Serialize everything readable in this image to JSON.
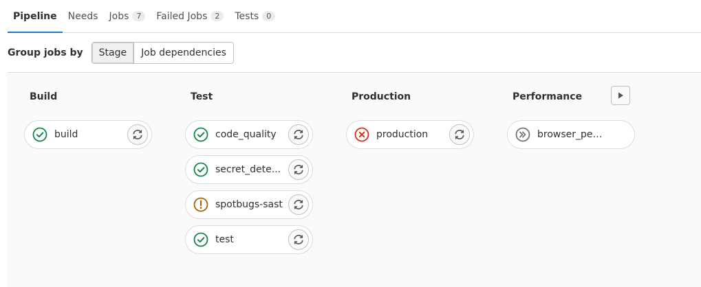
{
  "tabs": [
    {
      "label": "Pipeline",
      "active": true
    },
    {
      "label": "Needs"
    },
    {
      "label": "Jobs",
      "count": "7"
    },
    {
      "label": "Failed Jobs",
      "count": "2"
    },
    {
      "label": "Tests",
      "count": "0"
    }
  ],
  "group_by": {
    "label": "Group jobs by",
    "options": [
      "Stage",
      "Job dependencies"
    ],
    "selected": "Stage"
  },
  "stages": [
    {
      "title": "Build",
      "jobs": [
        {
          "name": "build",
          "status": "success"
        }
      ]
    },
    {
      "title": "Test",
      "jobs": [
        {
          "name": "code_quality",
          "status": "success"
        },
        {
          "name": "secret_dete...",
          "status": "success"
        },
        {
          "name": "spotbugs-sast",
          "status": "warning"
        },
        {
          "name": "test",
          "status": "success"
        }
      ]
    },
    {
      "title": "Production",
      "jobs": [
        {
          "name": "production",
          "status": "failed"
        }
      ]
    },
    {
      "title": "Performance",
      "jobs": [
        {
          "name": "browser_perf...",
          "status": "skipped"
        }
      ]
    }
  ],
  "colors": {
    "success": "#108548",
    "warning": "#ab6100",
    "failed": "#dd2b0e",
    "skipped": "#737278",
    "active_tab": "#1f75cb"
  },
  "icons": {
    "success": "check-circle-icon",
    "warning": "warning-circle-icon",
    "failed": "x-circle-icon",
    "skipped": "skip-circle-icon",
    "retry": "retry-icon",
    "play": "play-icon"
  }
}
